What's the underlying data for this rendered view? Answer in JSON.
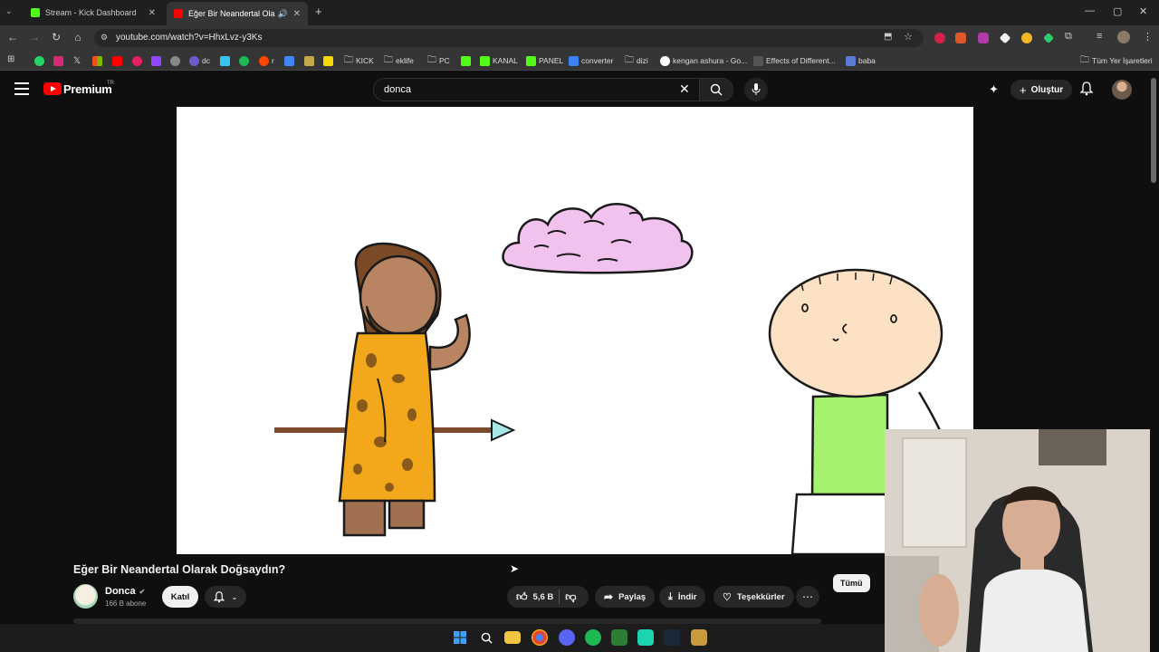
{
  "tabs": [
    {
      "title": "Stream - Kick Dashboard",
      "active": false
    },
    {
      "title": "Eğer Bir Neandertal Olarak",
      "active": true
    }
  ],
  "address_bar": {
    "url": "youtube.com/watch?v=HhxLvz-y3Ks"
  },
  "bookmarks": [
    {
      "label": "dc",
      "icon": "app-icon"
    },
    {
      "label": "r",
      "icon": "reddit-icon"
    },
    {
      "label": "KICK",
      "icon": "folder-icon"
    },
    {
      "label": "eklife",
      "icon": "folder-icon"
    },
    {
      "label": "PC",
      "icon": "folder-icon"
    },
    {
      "label": "KANAL",
      "icon": "kick-icon"
    },
    {
      "label": "PANEL",
      "icon": "kick-icon"
    },
    {
      "label": "converter",
      "icon": "converter-icon"
    },
    {
      "label": "dizi",
      "icon": "folder-icon"
    },
    {
      "label": "kengan ashura - Go...",
      "icon": "google-icon"
    },
    {
      "label": "Effects of Different...",
      "icon": "page-icon"
    },
    {
      "label": "baba",
      "icon": "page-icon"
    }
  ],
  "all_bookmarks": "Tüm Yer İşaretleri",
  "youtube": {
    "brand": "Premium",
    "region": "TR",
    "search_value": "donca",
    "create_label": "Oluştur"
  },
  "video": {
    "title": "Eğer Bir Neandertal Olarak Doğsaydın?",
    "channel": "Donca",
    "subscribers": "166 B abone",
    "join_label": "Katıl",
    "likes": "5,6 B",
    "share_label": "Paylaş",
    "download_label": "İndir",
    "thanks_label": "Teşekkürler"
  },
  "chips": {
    "all_label": "Tümü"
  },
  "colors": {
    "youtube_red": "#ff0000",
    "kick_green": "#53fc18",
    "bg": "#0f0f0f"
  }
}
